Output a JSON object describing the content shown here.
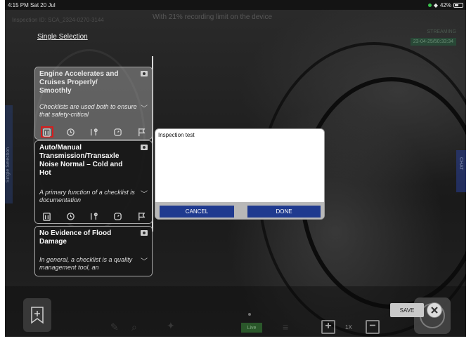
{
  "status_bar": {
    "time": "4:15 PM",
    "date": "Sat 20 Jul",
    "battery": "42%"
  },
  "background": {
    "banner": "With 21% recording limit on the device",
    "inspection_id": "Inspection ID: SCA_2324-0270-3144",
    "streaming_label": "STREAMING",
    "stream_time": "23-04-25/50:33:34"
  },
  "single_selection": "Single Selection",
  "side_tab_left": "Single Selection",
  "side_tab_right": "CHAT",
  "checklist": [
    {
      "title": "Engine Accelerates and Cruises Properly/ Smoothly",
      "description": "Checklists are used both to ensure that safety-critical"
    },
    {
      "title": "Auto/Manual Transmission/Transaxle Noise Normal – Cold and Hot",
      "description": "A primary function of a checklist is documentation"
    },
    {
      "title": "No Evidence of Flood Damage",
      "description": "In general, a checklist is a quality management tool, an"
    }
  ],
  "dialog": {
    "text": "Inspection test",
    "cancel_label": "CANCEL",
    "done_label": "DONE"
  },
  "toolbar": {
    "live_label": "Live",
    "zoom_level": "1X",
    "save_label": "SAVE"
  }
}
